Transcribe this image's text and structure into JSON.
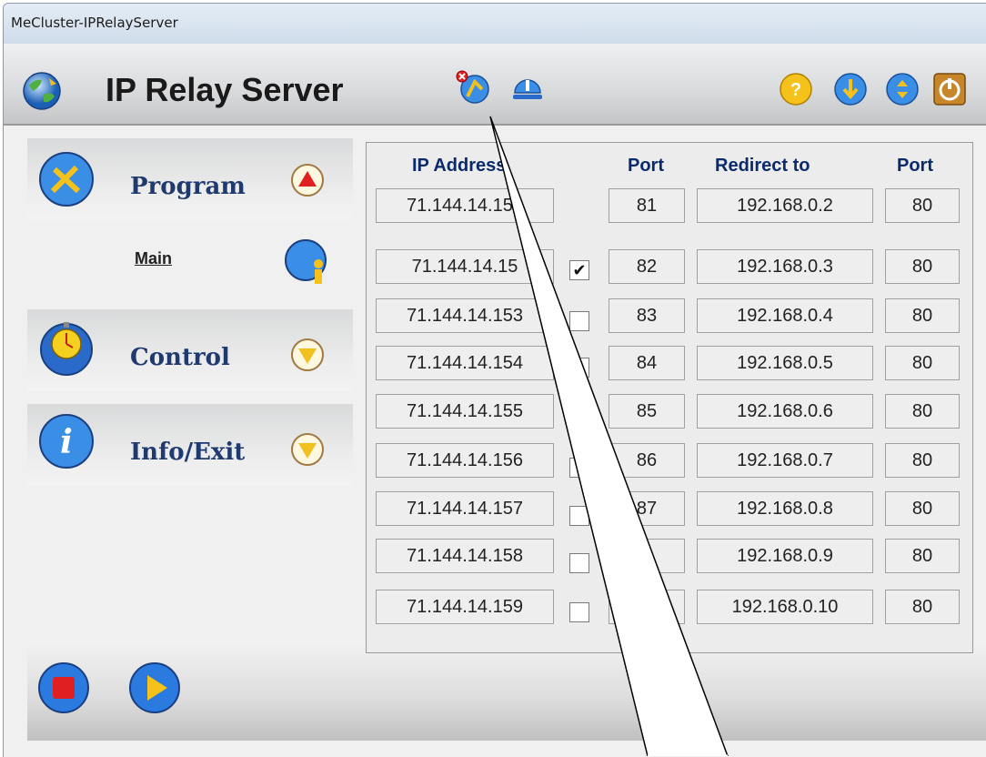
{
  "window": {
    "title": "MeCluster-IPRelayServer"
  },
  "toolbar": {
    "app_title": "IP Relay Server",
    "icons": [
      "connect-icon",
      "network-icon",
      "help-icon",
      "download-icon",
      "upload-icon",
      "power-icon"
    ]
  },
  "sidebar": {
    "sections": [
      {
        "label": "Program",
        "icon": "tools-icon",
        "arrow": "up-arrow-icon",
        "arrow_color": "#e02020"
      },
      {
        "label": "Control",
        "icon": "stopwatch-icon",
        "arrow": "down-arrow-icon",
        "arrow_color": "#f0c020"
      },
      {
        "label": "Info/Exit",
        "icon": "info-icon",
        "arrow": "down-arrow-icon",
        "arrow_color": "#f0c020"
      }
    ],
    "main_link": "Main"
  },
  "table": {
    "headers": {
      "ip": "IP Address",
      "port": "Port",
      "redirect": "Redirect to",
      "port2": "Port"
    },
    "rows": [
      {
        "ip": "71.144.14.151",
        "port": "81",
        "redirect": "192.168.0.2",
        "port2": "80",
        "checkbox": null
      },
      {
        "ip": "71.144.14.15",
        "port": "82",
        "redirect": "192.168.0.3",
        "port2": "80",
        "checkbox": true
      },
      {
        "ip": "71.144.14.153",
        "port": "83",
        "redirect": "192.168.0.4",
        "port2": "80",
        "checkbox": false
      },
      {
        "ip": "71.144.14.154",
        "port": "84",
        "redirect": "192.168.0.5",
        "port2": "80",
        "checkbox": false
      },
      {
        "ip": "71.144.14.155",
        "port": "85",
        "redirect": "192.168.0.6",
        "port2": "80",
        "checkbox": null
      },
      {
        "ip": "71.144.14.156",
        "port": "86",
        "redirect": "192.168.0.7",
        "port2": "80",
        "checkbox": false
      },
      {
        "ip": "71.144.14.157",
        "port": "87",
        "redirect": "192.168.0.8",
        "port2": "80",
        "checkbox": false
      },
      {
        "ip": "71.144.14.158",
        "port": "8",
        "redirect": "192.168.0.9",
        "port2": "80",
        "checkbox": false
      },
      {
        "ip": "71.144.14.159",
        "port": "",
        "redirect": "192.168.0.10",
        "port2": "80",
        "checkbox": false
      }
    ]
  },
  "bottom": {
    "icons": [
      "stop-icon",
      "play-icon"
    ]
  }
}
